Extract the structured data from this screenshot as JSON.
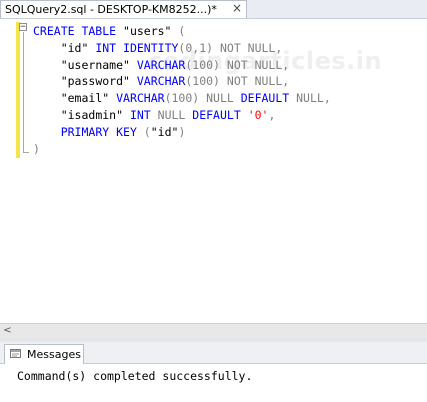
{
  "tab": {
    "title": "SQLQuery2.sql - DESKTOP-KM8252...)*",
    "close_glyph": "×"
  },
  "watermark": "codingarticles.in",
  "code": {
    "line1": {
      "kw": "CREATE TABLE",
      "rest": " \"users\" ",
      "paren": "("
    },
    "line2": {
      "col": "\"id\" ",
      "type": "INT IDENTITY",
      "args": "(0,1)",
      "tail": " NOT NULL,"
    },
    "line3": {
      "col": "\"username\" ",
      "type": "VARCHAR",
      "args": "(100)",
      "tail": " NOT NULL,"
    },
    "line4": {
      "col": "\"password\" ",
      "type": "VARCHAR",
      "args": "(100)",
      "tail": " NOT NULL,"
    },
    "line5": {
      "col": "\"email\" ",
      "type": "VARCHAR",
      "args": "(100)",
      "null": " NULL ",
      "def": "DEFAULT",
      "tail": " NULL,"
    },
    "line6": {
      "col": "\"isadmin\" ",
      "type": "INT",
      "null": " NULL ",
      "def": "DEFAULT",
      "sp": " ",
      "val": "'0'",
      "comma": ","
    },
    "line7": {
      "kw": "PRIMARY KEY",
      "open": " (",
      "col": "\"id\"",
      "close": ")"
    },
    "line8": {
      "paren": ")"
    }
  },
  "messages": {
    "tab_label": "Messages",
    "text": "Command(s) completed successfully."
  },
  "scroll": {
    "left_glyph": "<"
  }
}
